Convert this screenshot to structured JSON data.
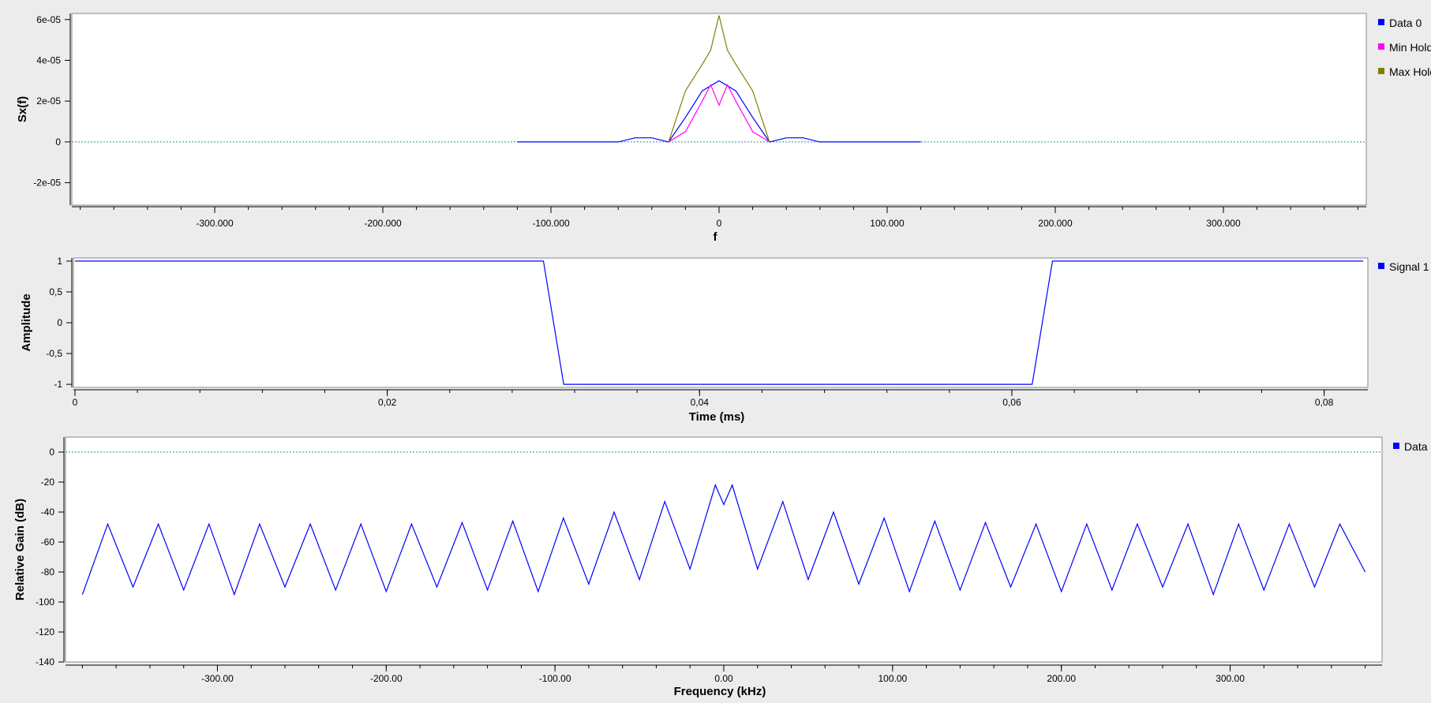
{
  "plots": [
    {
      "id": "psd",
      "ylabel": "Sx(f)",
      "xlabel": "f",
      "x_ticks": [
        "-300.000",
        "-200.000",
        "-100.000",
        "0",
        "100.000",
        "200.000",
        "300.000"
      ],
      "y_ticks": [
        "6e-05",
        "4e-05",
        "2e-05",
        "0",
        "-2e-05"
      ],
      "legend": [
        "Data 0",
        "Min Hold",
        "Max Hold"
      ]
    },
    {
      "id": "time",
      "ylabel": "Amplitude",
      "xlabel": "Time (ms)",
      "x_ticks": [
        "0",
        "0,02",
        "0,04",
        "0,06",
        "0,08"
      ],
      "y_ticks": [
        "1",
        "0,5",
        "0",
        "-0,5",
        "-1"
      ],
      "legend": [
        "Signal 1"
      ]
    },
    {
      "id": "freq",
      "ylabel": "Relative Gain (dB)",
      "xlabel": "Frequency (kHz)",
      "x_ticks": [
        "-300.00",
        "-200.00",
        "-100.00",
        "0.00",
        "100.00",
        "200.00",
        "300.00"
      ],
      "y_ticks": [
        "0",
        "-20",
        "-40",
        "-60",
        "-80",
        "-100",
        "-120",
        "-140"
      ],
      "legend": [
        "Data"
      ]
    }
  ],
  "chart_data": [
    {
      "type": "line",
      "ylabel": "Sx(f)",
      "xlabel": "f",
      "xlim": [
        -385,
        385
      ],
      "ylim": [
        -3.1e-05,
        6.3e-05
      ],
      "grid": false,
      "legend_position": "right",
      "series": [
        {
          "name": "Data 0",
          "color": "#0000ff",
          "x": [
            -120,
            -100,
            -80,
            -60,
            -50,
            -40,
            -30,
            -20,
            -10,
            0,
            10,
            20,
            30,
            40,
            50,
            60,
            80,
            100,
            120
          ],
          "values": [
            0,
            0,
            0,
            0,
            2e-06,
            2e-06,
            0,
            1.2e-05,
            2.5e-05,
            3e-05,
            2.5e-05,
            1.2e-05,
            0,
            2e-06,
            2e-06,
            0,
            0,
            0,
            0
          ]
        },
        {
          "name": "Min Hold",
          "color": "#ff00ff",
          "x": [
            -30,
            -20,
            -10,
            -5,
            0,
            5,
            10,
            20,
            30
          ],
          "values": [
            0,
            5e-06,
            2e-05,
            2.8e-05,
            1.8e-05,
            2.8e-05,
            2e-05,
            5e-06,
            0
          ]
        },
        {
          "name": "Max Hold",
          "color": "#808000",
          "x": [
            -30,
            -20,
            -10,
            -5,
            0,
            5,
            10,
            20,
            30
          ],
          "values": [
            0,
            2.5e-05,
            3.8e-05,
            4.5e-05,
            6.2e-05,
            4.5e-05,
            3.8e-05,
            2.5e-05,
            0
          ]
        }
      ]
    },
    {
      "type": "line",
      "ylabel": "Amplitude",
      "xlabel": "Time (ms)",
      "xlim": [
        -0.0001,
        0.0828
      ],
      "ylim": [
        -1.05,
        1.05
      ],
      "grid": false,
      "legend_position": "right",
      "series": [
        {
          "name": "Signal 1",
          "color": "#0000ff",
          "x": [
            0,
            0.03,
            0.0313,
            0.0613,
            0.0626,
            0.0825
          ],
          "values": [
            1,
            1,
            -1,
            -1,
            1,
            1
          ]
        }
      ]
    },
    {
      "type": "line",
      "ylabel": "Relative Gain (dB)",
      "xlabel": "Frequency (kHz)",
      "xlim": [
        -390,
        390
      ],
      "ylim": [
        -140,
        10
      ],
      "grid": false,
      "legend_position": "right",
      "series": [
        {
          "name": "Data",
          "color": "#0000ff",
          "note_values": "sidelobe comb pattern",
          "x": [
            -380,
            -365,
            -350,
            -335,
            -320,
            -305,
            -290,
            -275,
            -260,
            -245,
            -230,
            -215,
            -200,
            -185,
            -170,
            -155,
            -140,
            -125,
            -110,
            -95,
            -80,
            -65,
            -50,
            -35,
            -20,
            -5,
            0,
            5,
            20,
            35,
            50,
            65,
            80,
            95,
            110,
            125,
            140,
            155,
            170,
            185,
            200,
            215,
            230,
            245,
            260,
            275,
            290,
            305,
            320,
            335,
            350,
            365,
            380
          ],
          "values": [
            -95,
            -48,
            -90,
            -48,
            -92,
            -48,
            -95,
            -48,
            -90,
            -48,
            -92,
            -48,
            -93,
            -48,
            -90,
            -47,
            -92,
            -46,
            -93,
            -44,
            -88,
            -40,
            -85,
            -33,
            -78,
            -22,
            -35,
            -22,
            -78,
            -33,
            -85,
            -40,
            -88,
            -44,
            -93,
            -46,
            -92,
            -47,
            -90,
            -48,
            -93,
            -48,
            -92,
            -48,
            -90,
            -48,
            -95,
            -48,
            -92,
            -48,
            -90,
            -48,
            -80
          ]
        }
      ]
    }
  ]
}
